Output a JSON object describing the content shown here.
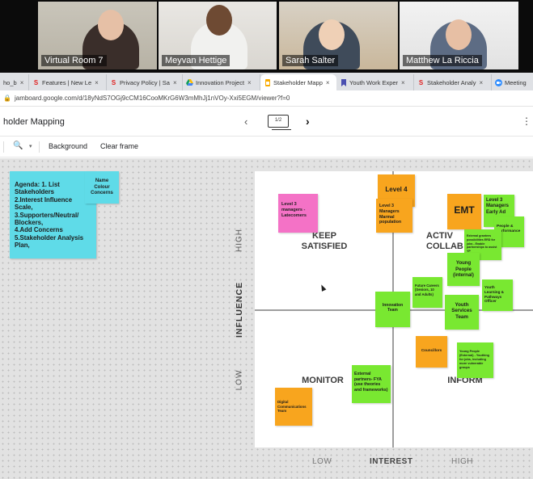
{
  "participants": [
    {
      "name": "Virtual Room 7"
    },
    {
      "name": "Meyvan Hettige"
    },
    {
      "name": "Sarah Salter"
    },
    {
      "name": "Matthew La Riccia"
    }
  ],
  "tabs": [
    {
      "label": "ho_b",
      "icon": "doc-icon"
    },
    {
      "label": "Features | New Le",
      "icon": "s-logo-icon"
    },
    {
      "label": "Privacy Policy | Sa",
      "icon": "s-logo-icon"
    },
    {
      "label": "Innovation Project",
      "icon": "drive-icon"
    },
    {
      "label": "Stakeholder Mapp",
      "icon": "jamboard-icon"
    },
    {
      "label": "Youth Work Exper",
      "icon": "bookmark-icon"
    },
    {
      "label": "Stakeholder Analy",
      "icon": "s-logo-icon"
    },
    {
      "label": "Meeting",
      "icon": "video-icon"
    }
  ],
  "url": "jamboard.google.com/d/18yNdS7OGj9cCM16CooMKrG6W3mMhJj1nVOy-Xxi5EGM/viewer?f=0",
  "app": {
    "title": "holder Mapping",
    "page_indicator": "1/2",
    "prev": "‹",
    "next": "›",
    "menu": "⋮"
  },
  "toolbar": {
    "zoom_icon": "🔍",
    "zoom_caret": "▾",
    "background_label": "Background",
    "clear_label": "Clear frame"
  },
  "board": {
    "quadrants": {
      "keep_satisfied": "KEEP\nSATISFIED",
      "active": "ACTIV\nCOLLAB",
      "monitor": "MONITOR",
      "inform": "INFORM"
    },
    "y_axis": {
      "title": "INFLUENCE",
      "high": "HIGH",
      "low": "LOW"
    },
    "x_axis": {
      "title": "INTEREST",
      "low": "LOW",
      "high": "HIGH"
    }
  },
  "notes": {
    "agenda": "Agenda: 1. List Stakeholders\n2.Interest Influence Scale,\n3.Supporters/Neutral/ Blockers,\n4.Add Concerns\n5.Stakeholder Analysis Plan,",
    "name_colour": "Name Colour Concerns",
    "level3_latecomers": "Level 3 managers - Latecomers",
    "level4": "Level 4",
    "level3_mgrs_pop": "Level 3 Managers Marmal population",
    "emt": "EMT",
    "level3_early": "Level 3 Managers Early Ad",
    "people_perf": "People & Performance",
    "ext_grants": "External grantees possibilities ERD for jobs - Enable partnerships to assist YP",
    "young_people_internal": "Young People (internal)",
    "future_careers": "Future Careers (Seniors, 10 and Adults)",
    "youth_learning": "Youth Learning & Pathways Officer",
    "innovation_team": "Innovation Team",
    "youth_services": "Youth Services Team",
    "councillors": "Councillors",
    "young_people_ext": "Young People (External) - Youthing for jobs, including more vulnerable groups",
    "ext_partners": "External partners- FYA (use theories and frameworks)",
    "digital_comms": "Digital Communications Team"
  }
}
